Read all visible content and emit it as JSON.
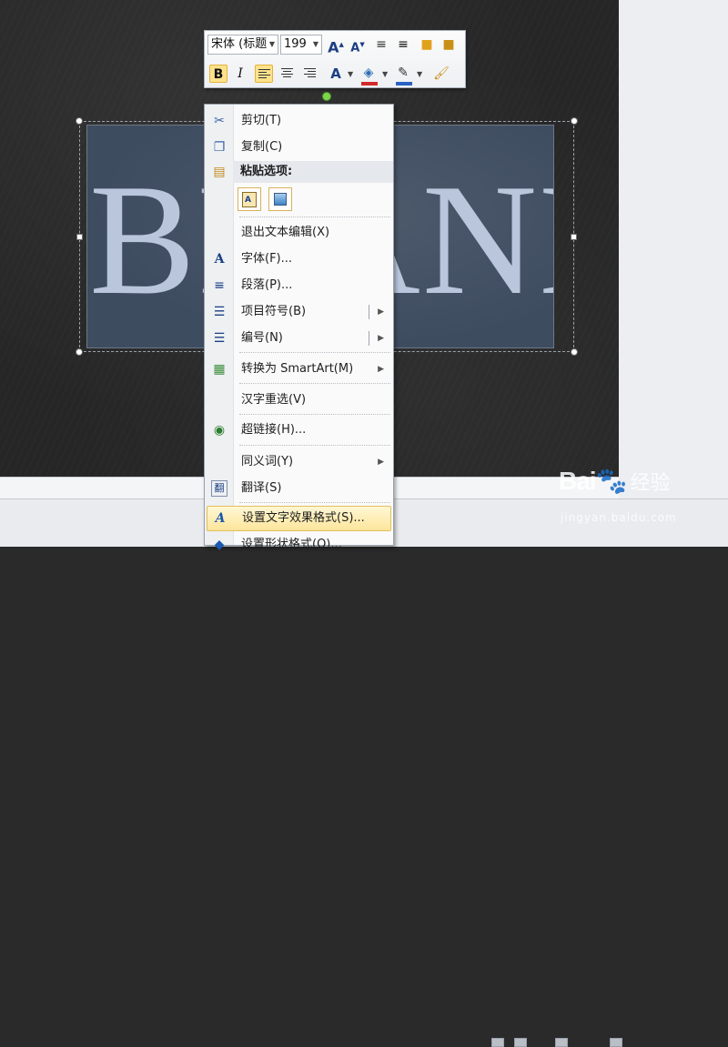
{
  "slide": {
    "big_text": "BRANDY"
  },
  "mini_toolbar": {
    "font_name": "宋体 (标题",
    "font_size": "199",
    "buttons": [
      {
        "name": "grow-font-icon",
        "glyph": "A"
      },
      {
        "name": "shrink-font-icon",
        "glyph": "A"
      },
      {
        "name": "decrease-indent-icon",
        "glyph": "≡"
      },
      {
        "name": "increase-indent-icon",
        "glyph": "≡"
      },
      {
        "name": "bring-forward-icon",
        "glyph": "■"
      },
      {
        "name": "send-backward-icon",
        "glyph": "■"
      }
    ],
    "bold": "B",
    "italic": "I",
    "font_color_glyph": "A"
  },
  "context_menu": {
    "items": [
      {
        "label": "剪切(T)",
        "icon": "scissors-icon",
        "glyph": "✂"
      },
      {
        "label": "复制(C)",
        "icon": "copy-icon",
        "glyph": "❐"
      },
      {
        "label": "粘贴选项:",
        "icon": "paste-icon",
        "glyph": "📋"
      },
      {
        "label": "退出文本编辑(X)",
        "icon": "",
        "glyph": ""
      },
      {
        "label": "字体(F)...",
        "icon": "font-icon",
        "glyph": "A"
      },
      {
        "label": "段落(P)...",
        "icon": "paragraph-icon",
        "glyph": "≡"
      },
      {
        "label": "项目符号(B)",
        "icon": "bullets-icon",
        "glyph": "☰"
      },
      {
        "label": "编号(N)",
        "icon": "numbering-icon",
        "glyph": "☰"
      },
      {
        "label": "转换为 SmartArt(M)",
        "icon": "smartart-icon",
        "glyph": "▦"
      },
      {
        "label": "汉字重选(V)",
        "icon": "",
        "glyph": ""
      },
      {
        "label": "超链接(H)...",
        "icon": "hyperlink-icon",
        "glyph": "🌐"
      },
      {
        "label": "同义词(Y)",
        "icon": "",
        "glyph": ""
      },
      {
        "label": "翻译(S)",
        "icon": "translate-icon",
        "glyph": "翻"
      },
      {
        "label": "设置文字效果格式(S)...",
        "icon": "text-effects-icon",
        "glyph": "A"
      },
      {
        "label": "设置形状格式(O)...",
        "icon": "shape-format-icon",
        "glyph": "◆"
      }
    ]
  },
  "watermark": {
    "logo": "Bai",
    "logo_tail": "经验",
    "url": "jingyan.baidu.com"
  }
}
